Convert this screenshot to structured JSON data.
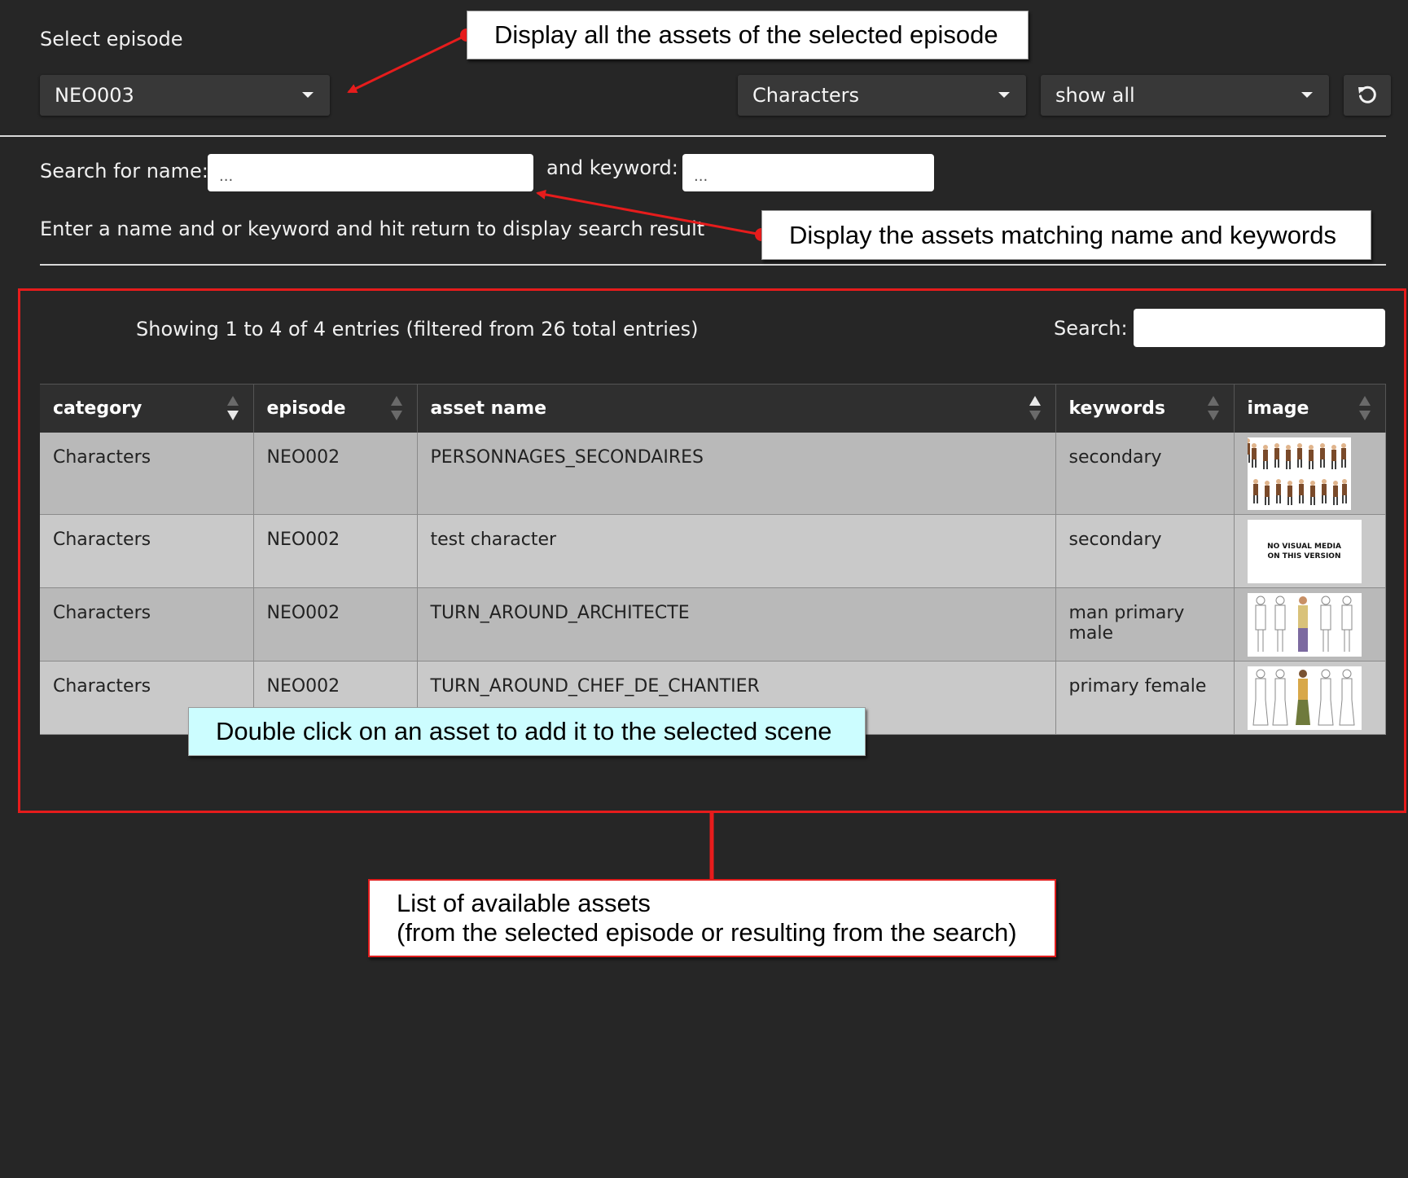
{
  "episode_select": {
    "label": "Select episode",
    "selected": "NEO003"
  },
  "filters": {
    "category": "Characters",
    "mode": "show all",
    "refresh_icon": "refresh-icon"
  },
  "search": {
    "name_label": "Search for name:",
    "name_placeholder": "...",
    "keyword_label": "and keyword:",
    "keyword_placeholder": "...",
    "hint": "Enter a name and or keyword and hit return to display search result"
  },
  "table_info": {
    "showing": "Showing 1 to 4 of 4 entries (filtered from 26 total entries)",
    "search_label": "Search:"
  },
  "table": {
    "columns": [
      "category",
      "episode",
      "asset name",
      "keywords",
      "image"
    ],
    "rows": [
      {
        "category": "Characters",
        "episode": "NEO002",
        "name": "PERSONNAGES_SECONDAIRES",
        "keywords": "secondary",
        "image": "character-lineup-thumbnail"
      },
      {
        "category": "Characters",
        "episode": "NEO002",
        "name": "test character",
        "keywords": "secondary",
        "image": "no-media-thumbnail",
        "image_text": "NO VISUAL MEDIA ON THIS VERSION"
      },
      {
        "category": "Characters",
        "episode": "NEO002",
        "name": "TURN_AROUND_ARCHITECTE",
        "keywords": "man primary male",
        "image": "turnaround-male-thumbnail"
      },
      {
        "category": "Characters",
        "episode": "NEO002",
        "name": "TURN_AROUND_CHEF_DE_CHANTIER",
        "keywords": "primary female",
        "image": "turnaround-female-thumbnail"
      }
    ]
  },
  "callouts": {
    "episode": "Display all the assets of the selected episode",
    "search": "Display the assets matching name and keywords",
    "double_click": "Double click on an asset to add it to the selected scene",
    "list_line1": "List of available assets",
    "list_line2": "(from the selected episode or resulting from the search)"
  },
  "colors": {
    "background": "#262626",
    "annotation_red": "#e61c1c",
    "callout_cyan": "#ccfdff"
  }
}
